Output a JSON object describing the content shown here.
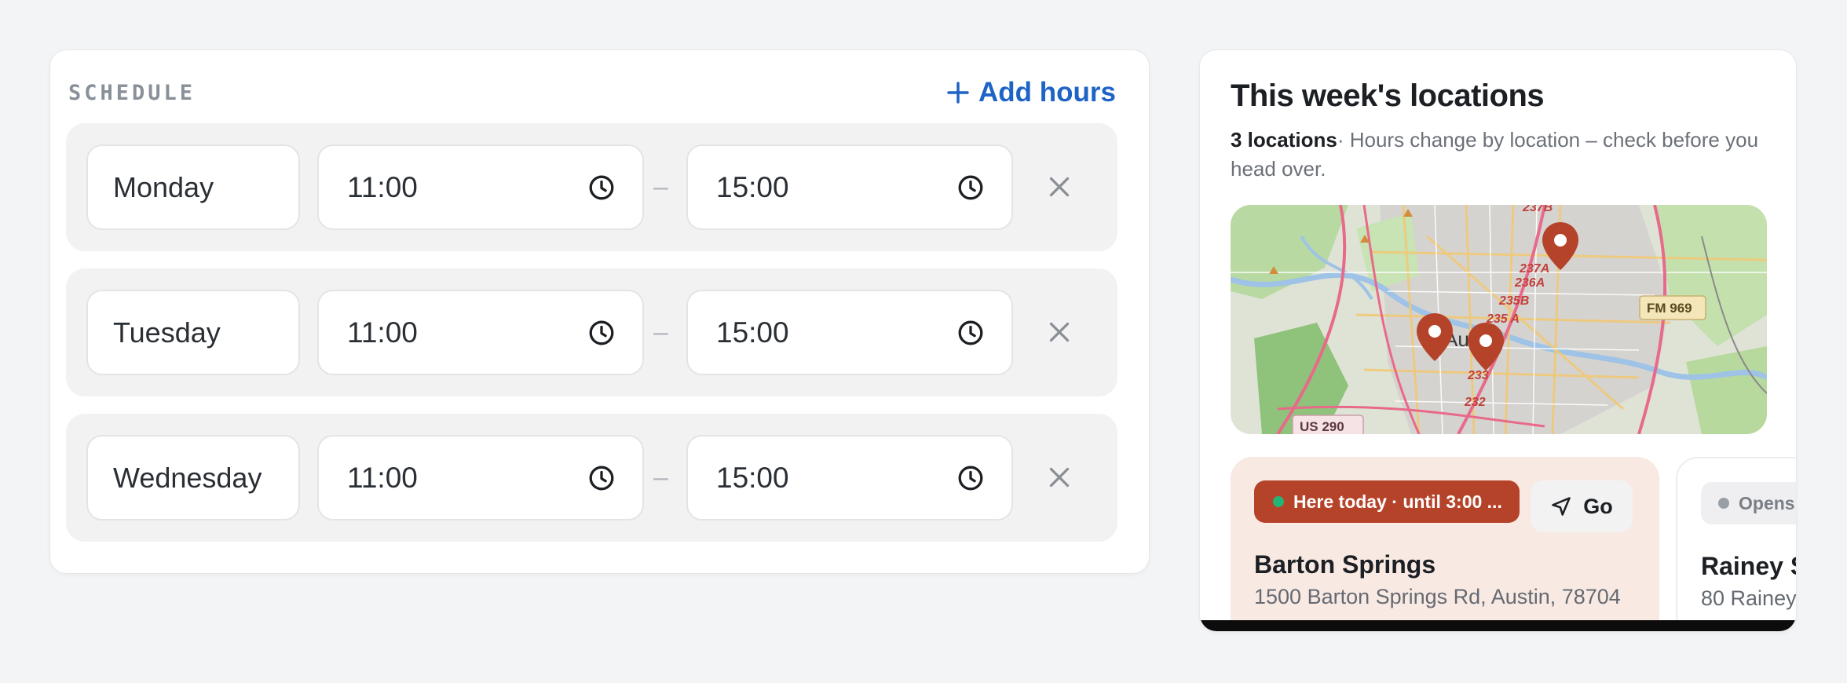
{
  "schedule": {
    "title": "SCHEDULE",
    "add_label": "Add hours",
    "rows": [
      {
        "day": "Monday",
        "start": "11:00",
        "end": "15:00"
      },
      {
        "day": "Tuesday",
        "start": "11:00",
        "end": "15:00"
      },
      {
        "day": "Wednesday",
        "start": "11:00",
        "end": "15:00"
      }
    ],
    "separator": "–"
  },
  "locations": {
    "title": "This week's locations",
    "count": "3 locations",
    "note": "· Hours change by location – check before you head over.",
    "map": {
      "labels": [
        "237B",
        "237A",
        "236A",
        "235B",
        "235 A",
        "233",
        "232",
        "FM 969",
        "US 290",
        "Austin"
      ]
    },
    "items": [
      {
        "status": "Here today · until 3:00 ...",
        "go_label": "Go",
        "name": "Barton Springs",
        "address": "1500 Barton Springs Rd, Austin, 78704"
      },
      {
        "status": "Opens",
        "name": "Rainey St",
        "address": "80 Rainey"
      }
    ]
  },
  "colors": {
    "accent": "#1e63c6",
    "brand": "#b5432a",
    "status_open": "#22b573"
  }
}
